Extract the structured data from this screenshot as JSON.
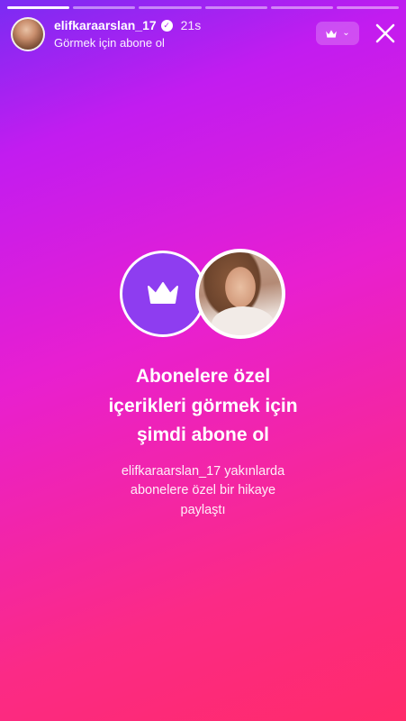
{
  "header": {
    "username": "elifkaraarslan_17",
    "verified_icon": "verified-badge-icon",
    "time": "21s",
    "subtitle": "Görmek için abone ol"
  },
  "subscribe_badge": {
    "icon": "crown-icon",
    "chevron": "⌄"
  },
  "close_icon": "close-icon",
  "progress": {
    "segments": 6,
    "completed": 1
  },
  "main": {
    "title_lines": [
      "Abonelere özel",
      "içerikleri görmek için",
      "şimdi abone ol"
    ],
    "description_lines": [
      "elifkaraarslan_17 yakınlarda",
      "abonelere özel bir hikaye",
      "paylaştı"
    ]
  },
  "colors": {
    "gradient_top": "#7a2cf3",
    "gradient_mid": "#e81fd0",
    "gradient_bottom": "#ff2b6a",
    "crown_circle": "#8e3df0"
  }
}
